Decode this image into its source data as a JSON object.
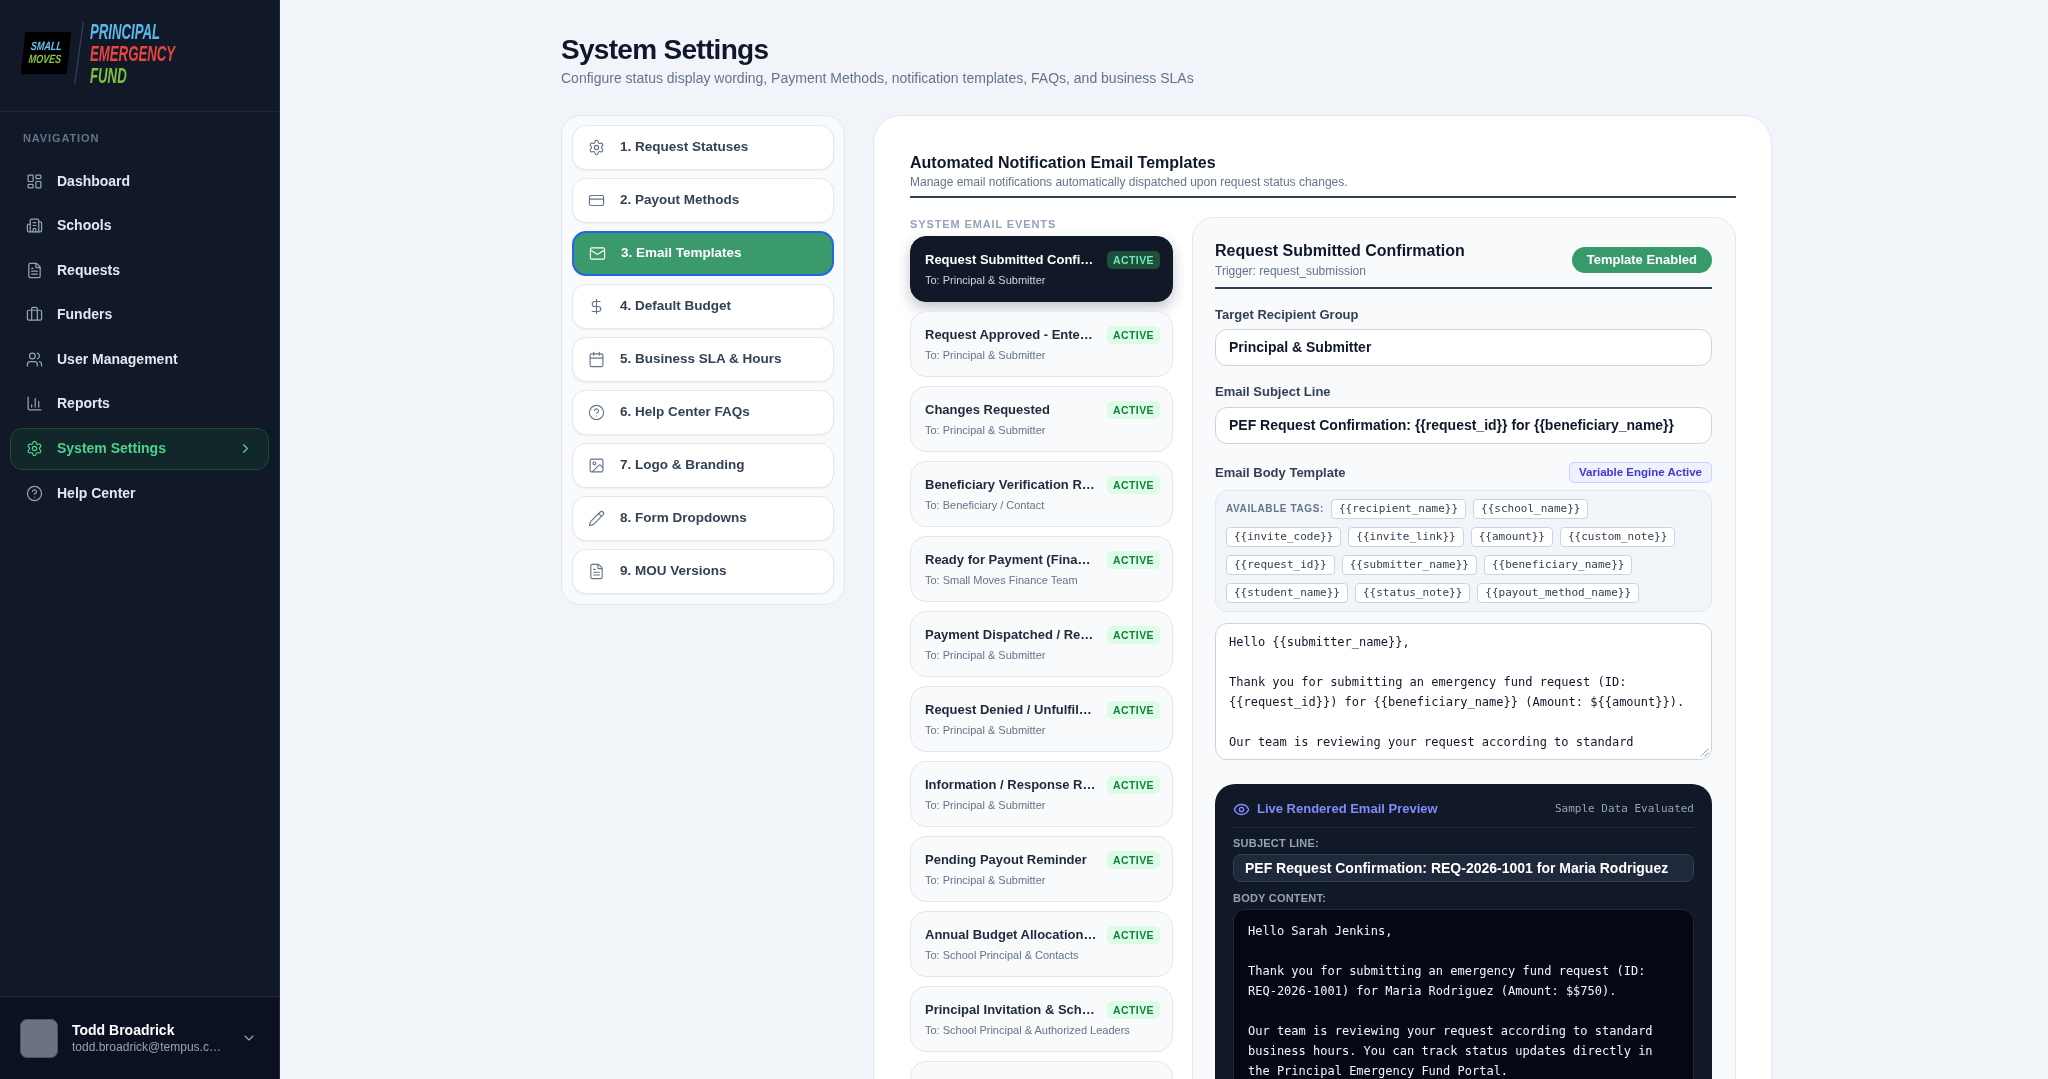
{
  "sidebar": {
    "logo": {
      "badge": [
        "SMALL",
        "MOVES"
      ],
      "wordmark": [
        "PRINCIPAL",
        "EMERGENCY",
        "FUND"
      ]
    },
    "section_label": "NAVIGATION",
    "nav_items": [
      {
        "label": "Dashboard",
        "selected": false
      },
      {
        "label": "Schools",
        "selected": false
      },
      {
        "label": "Requests",
        "selected": false
      },
      {
        "label": "Funders",
        "selected": false
      },
      {
        "label": "User Management",
        "selected": false
      },
      {
        "label": "Reports",
        "selected": false
      },
      {
        "label": "System Settings",
        "selected": true
      },
      {
        "label": "Help Center",
        "selected": false
      }
    ],
    "user": {
      "name": "Todd Broadrick",
      "email": "todd.broadrick@tempus.c…"
    }
  },
  "page": {
    "title": "System Settings",
    "subtitle": "Configure status display wording, Payment Methods, notification templates, FAQs, and business SLAs"
  },
  "settings_menu": [
    {
      "label": "1. Request Statuses",
      "selected": false
    },
    {
      "label": "2. Payout Methods",
      "selected": false
    },
    {
      "label": "3. Email Templates",
      "selected": true
    },
    {
      "label": "4. Default Budget",
      "selected": false
    },
    {
      "label": "5. Business SLA & Hours",
      "selected": false
    },
    {
      "label": "6. Help Center FAQs",
      "selected": false
    },
    {
      "label": "7. Logo & Branding",
      "selected": false
    },
    {
      "label": "8. Form Dropdowns",
      "selected": false
    },
    {
      "label": "9. MOU Versions",
      "selected": false
    }
  ],
  "templates_panel": {
    "title": "Automated Notification Email Templates",
    "subtitle": "Manage email notifications automatically dispatched upon request status changes.",
    "events_heading": "SYSTEM EMAIL EVENTS",
    "events": [
      {
        "kind": "event",
        "title": "Request Submitted Confi…",
        "recipients": "To: Principal & Submitter",
        "status": "ACTIVE",
        "selected": true
      },
      {
        "kind": "event",
        "title": "Request Approved - Ente…",
        "recipients": "To: Principal & Submitter",
        "status": "ACTIVE",
        "selected": false
      },
      {
        "kind": "event",
        "title": "Changes Requested",
        "recipients": "To: Principal & Submitter",
        "status": "ACTIVE",
        "selected": false
      },
      {
        "kind": "event",
        "title": "Beneficiary Verification R…",
        "recipients": "To: Beneficiary / Contact",
        "status": "ACTIVE",
        "selected": false
      },
      {
        "kind": "event",
        "title": "Ready for Payment (Fina…",
        "recipients": "To: Small Moves Finance Team",
        "status": "ACTIVE",
        "selected": false
      },
      {
        "kind": "event",
        "title": "Payment Dispatched / Re…",
        "recipients": "To: Principal & Submitter",
        "status": "ACTIVE",
        "selected": false
      },
      {
        "kind": "event",
        "title": "Request Denied / Unfulfil…",
        "recipients": "To: Principal & Submitter",
        "status": "ACTIVE",
        "selected": false
      },
      {
        "kind": "event",
        "title": "Information / Response R…",
        "recipients": "To: Principal & Submitter",
        "status": "ACTIVE",
        "selected": false
      },
      {
        "kind": "event",
        "title": "Pending Payout Reminder",
        "recipients": "To: Principal & Submitter",
        "status": "ACTIVE",
        "selected": false
      },
      {
        "kind": "event",
        "title": "Annual Budget Allocation…",
        "recipients": "To: School Principal & Contacts",
        "status": "ACTIVE",
        "selected": false
      },
      {
        "kind": "event",
        "title": "Principal Invitation & Sch…",
        "recipients": "To: School Principal & Authorized Leaders",
        "status": "ACTIVE",
        "selected": false
      },
      {
        "kind": "clipped"
      }
    ]
  },
  "editor": {
    "title": "Request Submitted Confirmation",
    "trigger": "Trigger: request_submission",
    "status_button": "Template Enabled",
    "recipient_label": "Target Recipient Group",
    "recipient_value": "Principal & Submitter",
    "subject_label": "Email Subject Line",
    "subject_value": "PEF Request Confirmation: {{request_id}} for {{beneficiary_name}}",
    "body_label": "Email Body Template",
    "engine_badge": "Variable Engine Active",
    "tags_label": "AVAILABLE TAGS:",
    "tags": [
      "{{recipient_name}}",
      "{{school_name}}",
      "{{invite_code}}",
      "{{invite_link}}",
      "{{amount}}",
      "{{custom_note}}",
      "{{request_id}}",
      "{{submitter_name}}",
      "{{beneficiary_name}}",
      "{{student_name}}",
      "{{status_note}}",
      "{{payout_method_name}}"
    ],
    "body_value": "Hello {{submitter_name}},\n\nThank you for submitting an emergency fund request (ID: {{request_id}}) for {{beneficiary_name}} (Amount: ${{amount}}).\n\nOur team is reviewing your request according to standard"
  },
  "preview": {
    "title": "Live Rendered Email Preview",
    "note": "Sample Data Evaluated",
    "subject_label": "SUBJECT LINE:",
    "subject": "PEF Request Confirmation: REQ-2026-1001 for Maria Rodriguez",
    "body_label": "BODY CONTENT:",
    "body": "Hello Sarah Jenkins,\n\nThank you for submitting an emergency fund request (ID: REQ-2026-1001) for Maria Rodriguez (Amount: $$750).\n\nOur team is reviewing your request according to standard business hours. You can track status updates directly in the Principal Emergency Fund Portal."
  }
}
